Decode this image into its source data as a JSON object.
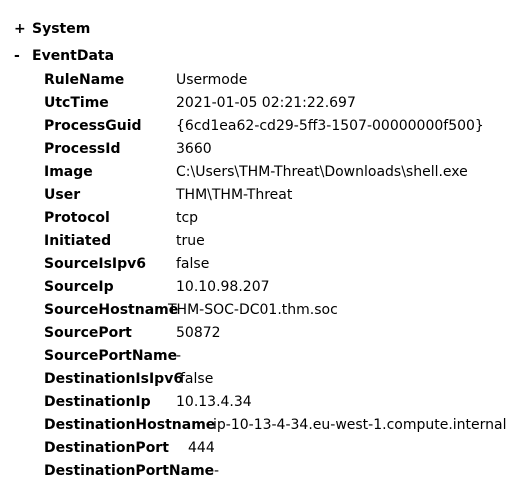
{
  "tree": {
    "system": {
      "toggle": "+",
      "label": "System"
    },
    "eventdata": {
      "toggle": "-",
      "label": "EventData"
    }
  },
  "rows": [
    {
      "name": "RuleName",
      "value": "Usermode"
    },
    {
      "name": "UtcTime",
      "value": "2021-01-05 02:21:22.697"
    },
    {
      "name": "ProcessGuid",
      "value": "{6cd1ea62-cd29-5ff3-1507-00000000f500}"
    },
    {
      "name": "ProcessId",
      "value": "3660"
    },
    {
      "name": "Image",
      "value": "C:\\Users\\THM-Threat\\Downloads\\shell.exe"
    },
    {
      "name": "User",
      "value": "THM\\THM-Threat"
    },
    {
      "name": "Protocol",
      "value": "tcp"
    },
    {
      "name": "Initiated",
      "value": "true"
    },
    {
      "name": "SourceIsIpv6",
      "value": "false"
    },
    {
      "name": "SourceIp",
      "value": "10.10.98.207"
    },
    {
      "name": "SourceHostname",
      "value": "THM-SOC-DC01.thm.soc"
    },
    {
      "name": "SourcePort",
      "value": "50872"
    },
    {
      "name": "SourcePortName",
      "value": "-"
    },
    {
      "name": "DestinationIsIpv6",
      "value": "false"
    },
    {
      "name": "DestinationIp",
      "value": "10.13.4.34"
    },
    {
      "name": "DestinationHostname",
      "value": "ip-10-13-4-34.eu-west-1.compute.internal"
    },
    {
      "name": "DestinationPort",
      "value": "444"
    },
    {
      "name": "DestinationPortName",
      "value": "-"
    }
  ]
}
